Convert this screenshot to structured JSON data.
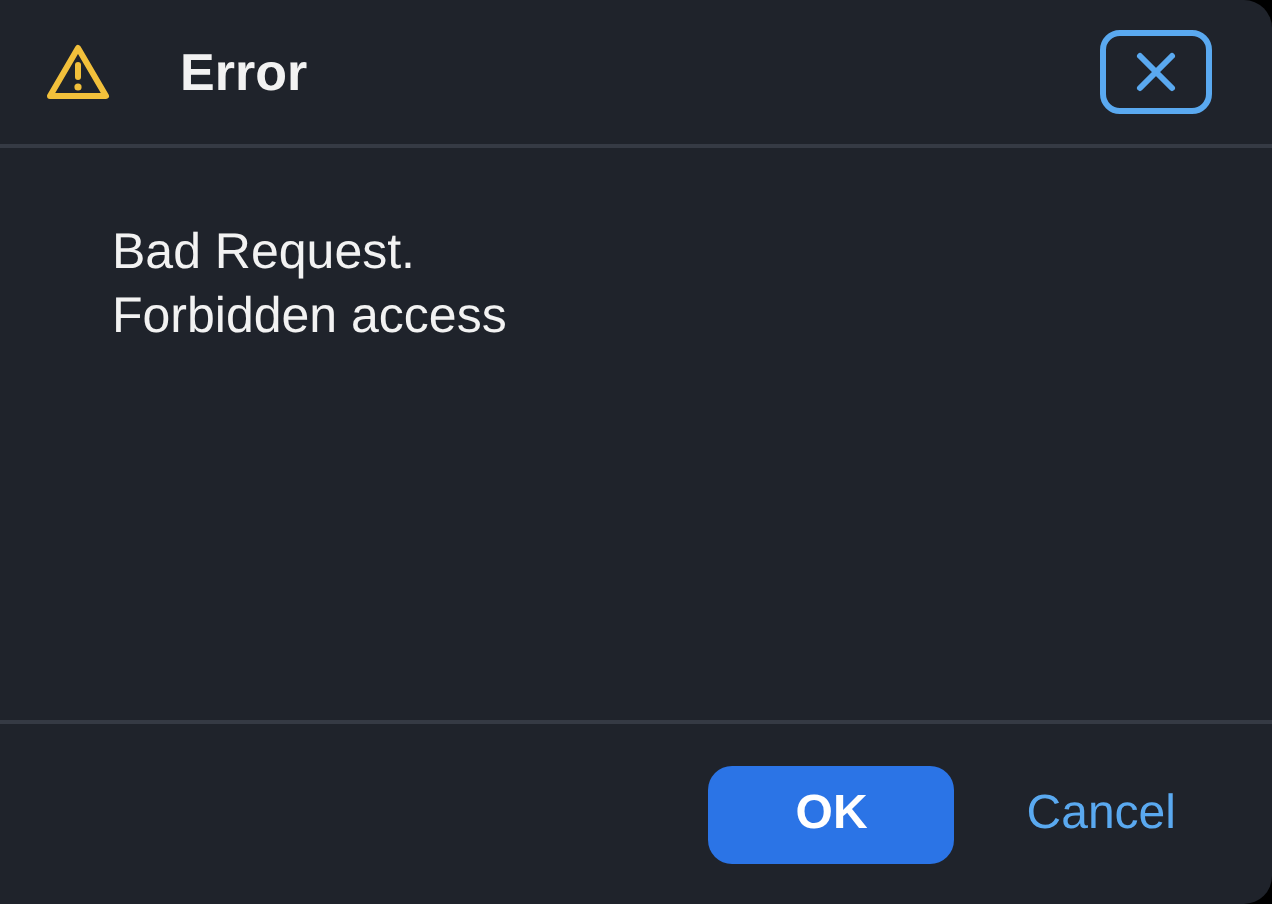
{
  "dialog": {
    "title": "Error",
    "message_lines": [
      "Bad Request.",
      "Forbidden access"
    ],
    "buttons": [
      {
        "label": "OK",
        "kind": "primary"
      },
      {
        "label": "Cancel",
        "kind": "ghost"
      }
    ]
  }
}
